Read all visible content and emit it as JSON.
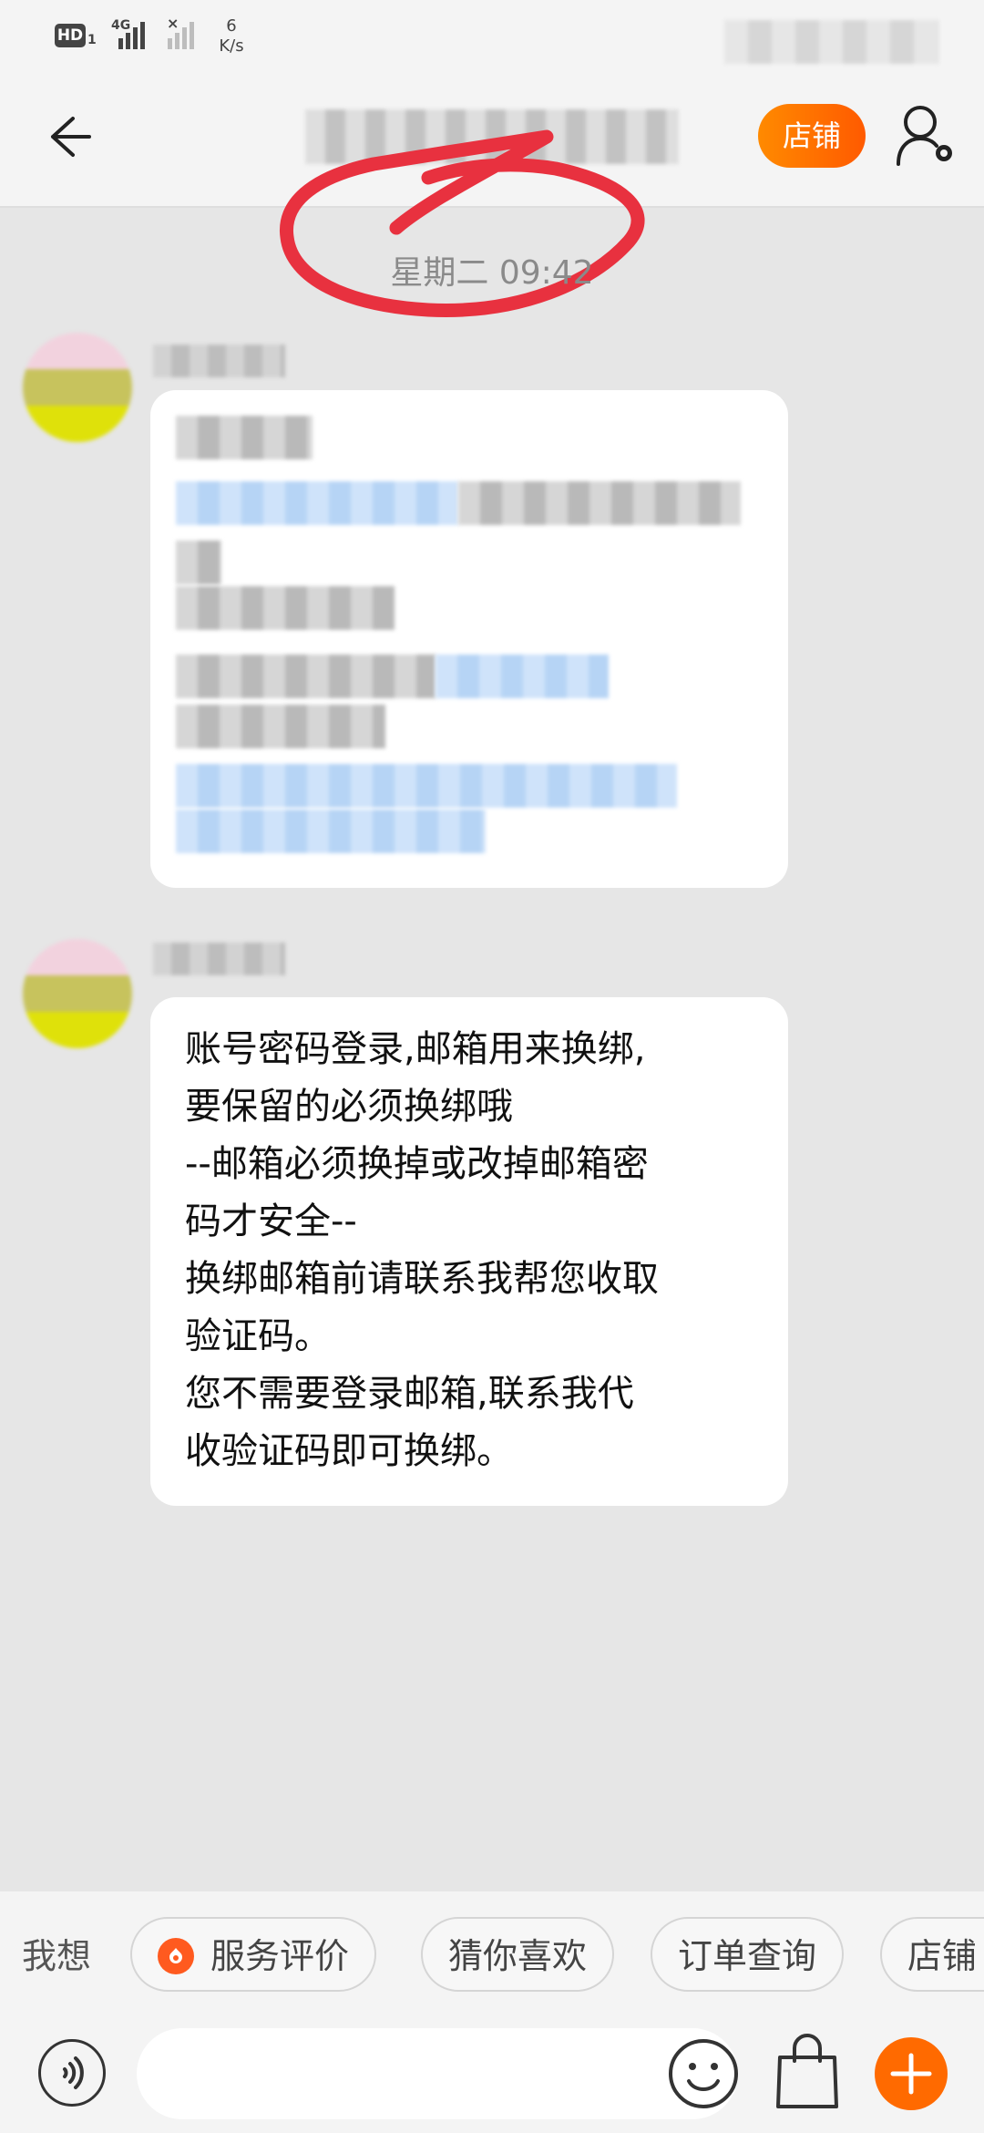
{
  "status_bar": {
    "hd": "HD",
    "sim": "1",
    "network": "4G",
    "speed_value": "6",
    "speed_unit": "K/s"
  },
  "header": {
    "store_button_label": "店铺"
  },
  "timestamp": "星期二 09:42",
  "messages": [
    {
      "text": "账号密码登录,邮箱用来换绑,\n要保留的必须换绑哦\n--邮箱必须换掉或改掉邮箱密\n码才安全--\n换绑邮箱前请联系我帮您收取\n验证码。\n您不需要登录邮箱,联系我代\n收验证码即可换绑。"
    }
  ],
  "quick_bar": {
    "prefix": "我想",
    "chips": [
      "服务评价",
      "猜你喜欢",
      "订单查询",
      "店铺"
    ]
  },
  "colors": {
    "accent": "#ff6a00",
    "annotation_red": "#e8313f"
  },
  "icons": [
    "back-arrow-icon",
    "user-settings-icon",
    "voice-icon",
    "emoji-icon",
    "shopping-bag-icon",
    "plus-icon",
    "service-rating-icon"
  ]
}
